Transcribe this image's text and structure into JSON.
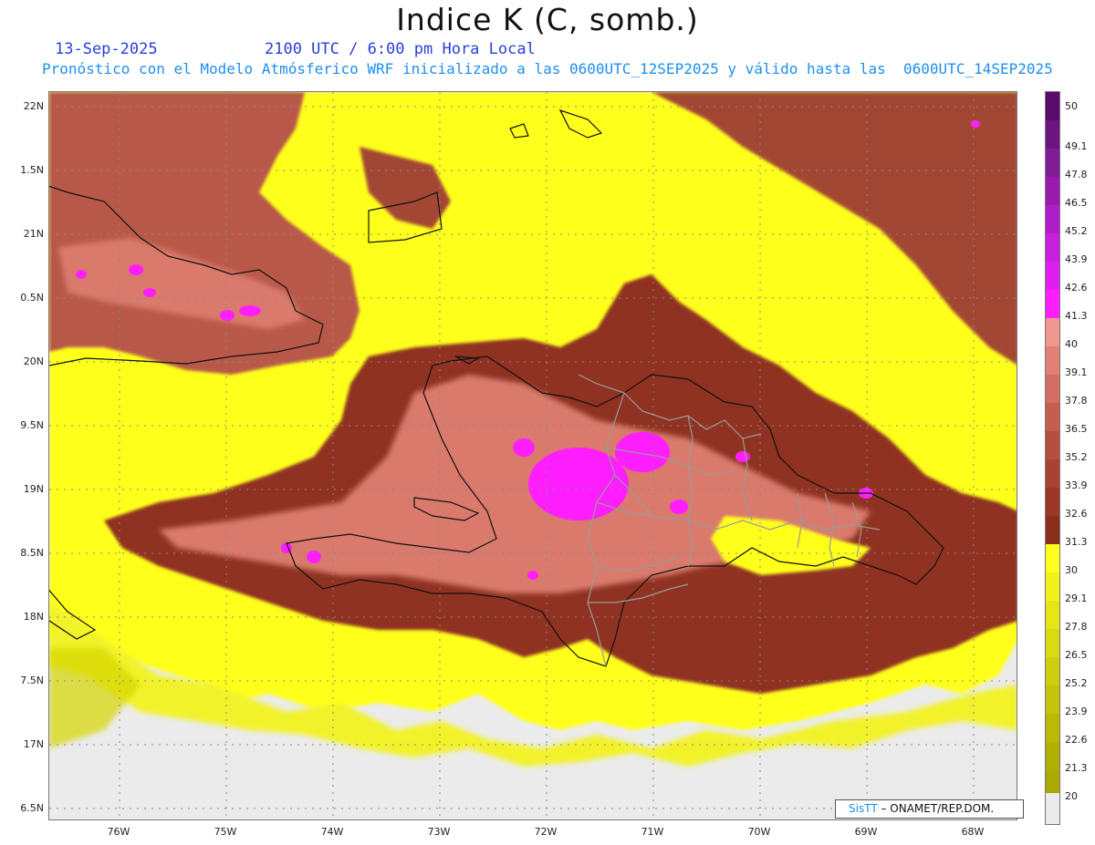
{
  "header": {
    "title": "Indice K (C, somb.)",
    "date": "13-Sep-2025",
    "time": "2100 UTC / 6:00 pm Hora Local",
    "subtitle": "Pronóstico con el Modelo Atmósferico WRF inicializado a las 0600UTC_12SEP2025 y válido hasta las  0600UTC_14SEP2025"
  },
  "axes": {
    "lat_labels": [
      "22N",
      "1.5N",
      "21N",
      "0.5N",
      "20N",
      "9.5N",
      "19N",
      "8.5N",
      "18N",
      "7.5N",
      "17N",
      "6.5N"
    ],
    "lon_labels": [
      "76W",
      "75W",
      "74W",
      "73W",
      "72W",
      "71W",
      "70W",
      "69W",
      "68W"
    ]
  },
  "colorbar": {
    "labels": [
      "50",
      "49.1",
      "47.8",
      "46.5",
      "45.2",
      "43.9",
      "42.6",
      "41.3",
      "40",
      "39.1",
      "37.8",
      "36.5",
      "35.2",
      "33.9",
      "32.6",
      "31.3",
      "30",
      "29.1",
      "27.8",
      "26.5",
      "25.2",
      "23.9",
      "22.6",
      "21.3",
      "20"
    ],
    "colors": {
      "magenta_high": "#6a0a78",
      "magenta_mid": "#c020d8",
      "magenta_low": "#ff20ff",
      "salmon": "#e88a80",
      "brown_mid": "#c05a4c",
      "brown_dark": "#8c2e1e",
      "yellow": "#ffff1e",
      "olive": "#b8b800",
      "land_missing": "#ebebeb"
    }
  },
  "credit": {
    "brand": "SisTT",
    "text": " – ONAMET/REP.DOM."
  }
}
